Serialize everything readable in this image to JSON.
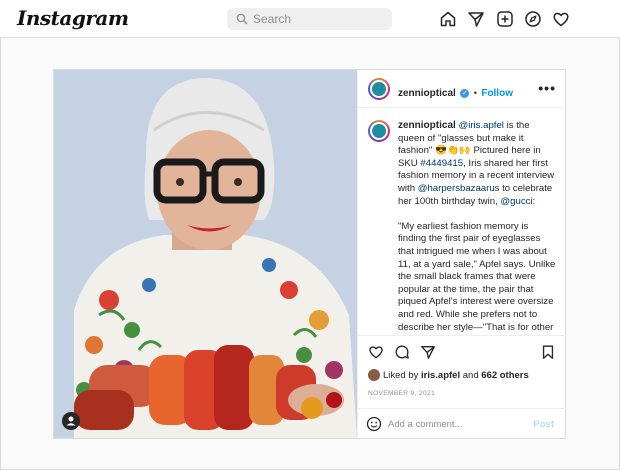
{
  "header": {
    "logo": "Instagram",
    "search_placeholder": "Search",
    "nav_icons": [
      "home-icon",
      "direct-message-icon",
      "new-post-icon",
      "explore-icon",
      "activity-heart-icon"
    ]
  },
  "post": {
    "author": "zennioptical",
    "follow_label": "Follow",
    "separator": "•",
    "more_label": "•••",
    "caption": {
      "username": "zennioptical",
      "mention_iris": "@iris.apfel",
      "part1": " is the queen of \"glasses but make it fashion\" 😎👏🙌 Pictured here in SKU ",
      "sku": "#4449415",
      "part2": ", Iris shared her first fashion memory in a recent interview with ",
      "mention_harpers": "@harpersbazaarus",
      "part3": " to celebrate her 100th birthday twin, ",
      "mention_gucci": "@gucci",
      "part4": ":",
      "quote": "\"My earliest fashion memory is finding the first pair of eyeglasses that intrigued me when I was about 11, at a yard sale,\" Apfel says. Unlike the small black frames that were popular at the time, the pair that piqued Apfel's interest were oversize and red. While she prefers not to describe her style—\"That is for other people to do,\" she says—the New York native affirms that it's been the same her whole life."
    },
    "likes": {
      "prefix": "Liked by ",
      "user": "iris.apfel",
      "middle": " and ",
      "others": "662 others"
    },
    "date": "NOVEMBER 9, 2021",
    "comment_placeholder": "Add a comment...",
    "post_label": "Post"
  },
  "colors": {
    "link": "#00376b",
    "follow": "#0095f6",
    "post_disabled": "#b3dbff"
  }
}
